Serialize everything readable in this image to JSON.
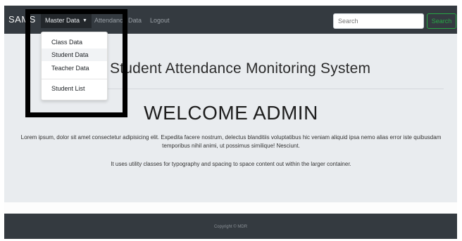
{
  "navbar": {
    "brand": "SAMS",
    "master_data_label": "Master Data",
    "attendance_label": "Attendance Data",
    "logout_label": "Logout",
    "search_placeholder": "Search",
    "search_button": "Search"
  },
  "dropdown": {
    "items": [
      "Class Data",
      "Student Data",
      "Teacher Data",
      "Student List"
    ]
  },
  "jumbotron": {
    "title": "Student Attendance Monitoring System",
    "welcome": "WELCOME ADMIN",
    "lead": "Lorem ipsum, dolor sit amet consectetur adipisicing elit. Expedita facere nostrum, delectus blanditiis voluptatibus hic veniam aliquid ipsa nemo alias error iste quibusdam temporibus nihil animi, ut possimus similique! Nesciunt.",
    "info": "It uses utility classes for typography and spacing to space content out within the larger container."
  },
  "footer": {
    "copyright": "Copyright © MDR"
  },
  "colors": {
    "navbar_bg": "#343a40",
    "jumbotron_bg": "#e9ecef",
    "search_button": "#28a745",
    "annotation_box": "#000000"
  }
}
